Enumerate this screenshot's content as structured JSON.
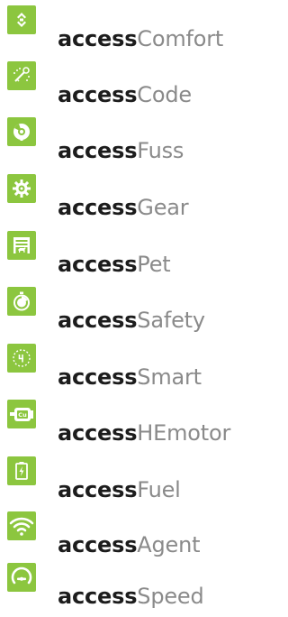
{
  "colors": {
    "icon_bg": "#8cc63f",
    "bold_text": "#1c1c1c",
    "light_text": "#8a8a8a"
  },
  "items": [
    {
      "prefix": "access",
      "suffix": "Comfort",
      "icon": "chevrons-up-down-icon"
    },
    {
      "prefix": "access",
      "suffix": "Code",
      "icon": "key-code-icon"
    },
    {
      "prefix": "access",
      "suffix": "Fuss",
      "icon": "fuss-icon"
    },
    {
      "prefix": "access",
      "suffix": "Gear",
      "icon": "gear-icon"
    },
    {
      "prefix": "access",
      "suffix": "Pet",
      "icon": "pet-door-icon"
    },
    {
      "prefix": "access",
      "suffix": "Safety",
      "icon": "stopwatch-icon"
    },
    {
      "prefix": "access",
      "suffix": "Smart",
      "icon": "smart-digit-icon"
    },
    {
      "prefix": "access",
      "suffix": "HEmotor",
      "icon": "motor-cu-icon"
    },
    {
      "prefix": "access",
      "suffix": "Fuel",
      "icon": "battery-fuel-icon"
    },
    {
      "prefix": "access",
      "suffix": "Agent",
      "icon": "wifi-icon"
    },
    {
      "prefix": "access",
      "suffix": "Speed",
      "icon": "speedometer-icon"
    }
  ]
}
